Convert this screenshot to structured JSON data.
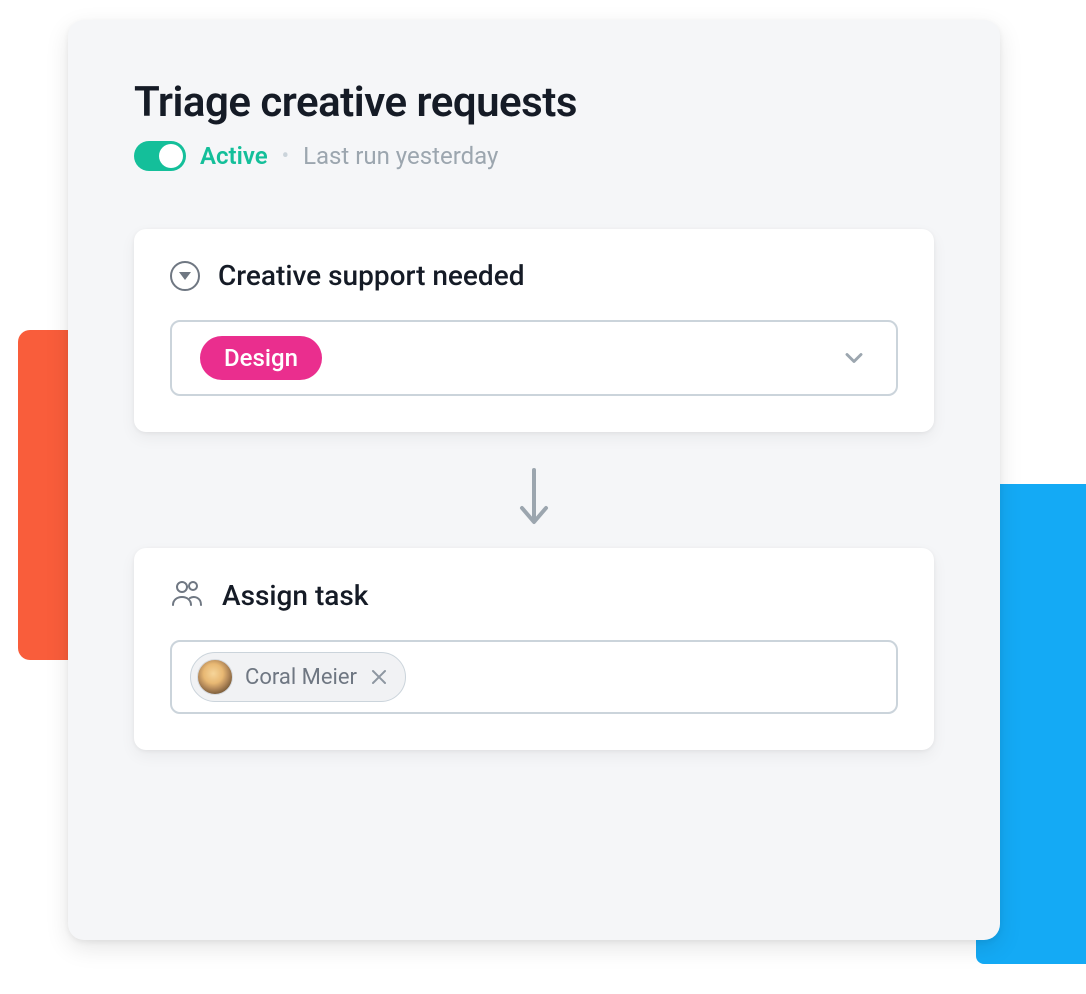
{
  "header": {
    "title": "Triage creative requests",
    "status_label": "Active",
    "last_run": "Last run yesterday",
    "toggle_on": true
  },
  "trigger_card": {
    "title": "Creative support needed",
    "selected_option": "Design"
  },
  "action_card": {
    "title": "Assign task",
    "assignee": {
      "name": "Coral Meier"
    }
  },
  "colors": {
    "accent_green": "#14bf9a",
    "chip_pink": "#ea2e8e",
    "bg_orange": "#f95d3b",
    "bg_blue": "#14aaf5"
  }
}
